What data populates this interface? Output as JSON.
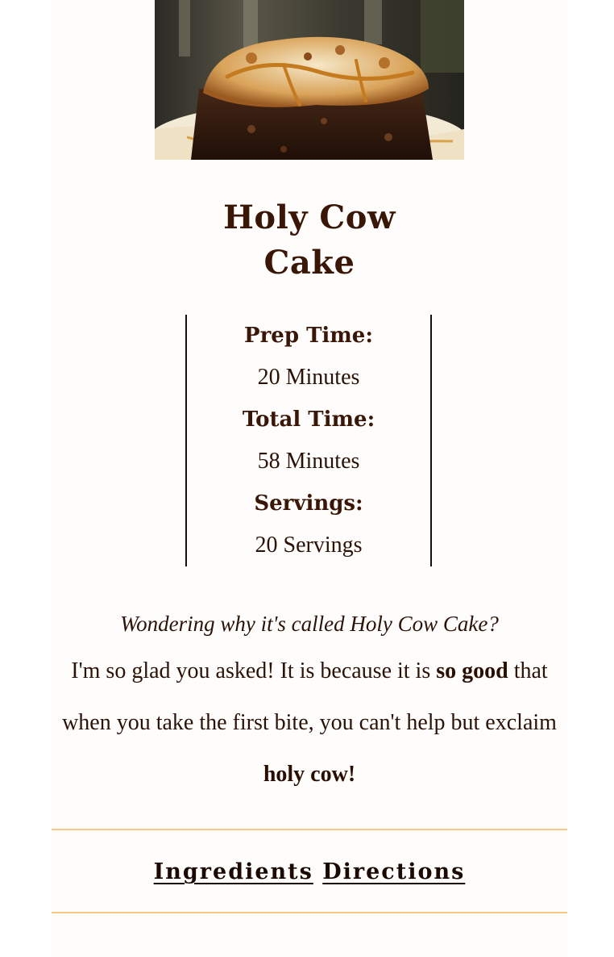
{
  "recipe": {
    "title_line1": "Holy Cow",
    "title_line2": "Cake",
    "hero_image": "chocolate-cake-slice-photo"
  },
  "meta": {
    "prep_label": "Prep Time:",
    "prep_value": "20 Minutes",
    "total_label": "Total Time:",
    "total_value": "58 Minutes",
    "servings_label": "Servings:",
    "servings_value": "20 Servings"
  },
  "blurb": {
    "question": "Wondering why it's called Holy Cow Cake?",
    "part1": "I'm so glad you asked! It is because it is ",
    "bold1": "so good",
    "part2": " that when you take the first bite, you can't help but exclaim ",
    "bold2": "holy cow!"
  },
  "nav": {
    "ingredients": "Ingredients",
    "directions": "Directions"
  },
  "colors": {
    "text": "#3a1606",
    "rule": "#f7c784",
    "background": "#fffdfc"
  }
}
